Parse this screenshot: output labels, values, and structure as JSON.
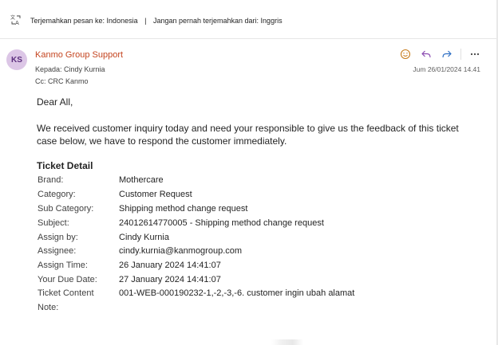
{
  "translate_bar": {
    "icon": "translate-icon",
    "translate_text": "Terjemahkan pesan ke: Indonesia",
    "separator": "|",
    "never_translate_text": "Jangan pernah terjemahkan dari: Inggris"
  },
  "message": {
    "avatar_initials": "KS",
    "avatar_color": "#dcc6e6",
    "sender": "Kanmo Group Support",
    "sender_color": "#c4441f",
    "to": "Kepada:  Cindy Kurnia",
    "cc": "Cc:  CRC Kanmo",
    "date": "Jum 26/01/2024 14.41",
    "actions": {
      "emoji_icon": "smiley-icon",
      "reply_icon": "reply-icon",
      "forward_icon": "forward-icon",
      "more_icon": "more-icon"
    }
  },
  "body": {
    "greeting": "Dear All,",
    "intro": "We received customer inquiry today and need your responsible to give us the feedback of this ticket case below, we have to respond the customer immediately.",
    "detail_title": "Ticket Detail",
    "details": [
      {
        "label": "Brand:",
        "value": "Mothercare"
      },
      {
        "label": "Category:",
        "value": "Customer Request"
      },
      {
        "label": "Sub Category:",
        "value": "Shipping method change request"
      },
      {
        "label": "Subject:",
        "value": "24012614770005 - Shipping method change request"
      },
      {
        "label": "Assign by:",
        "value": "Cindy Kurnia"
      },
      {
        "label": "Assignee:",
        "value": "cindy.kurnia@kanmogroup.com"
      },
      {
        "label": "Assign Time:",
        "value": "26 January 2024 14:41:07"
      },
      {
        "label": "Your Due Date:",
        "value": "27 January 2024 14:41:07"
      },
      {
        "label": "Ticket Content",
        "value": "001-WEB-000190232-1,-2,-3,-6. customer ingin ubah alamat"
      },
      {
        "label": "Note:",
        "value": ""
      }
    ]
  }
}
